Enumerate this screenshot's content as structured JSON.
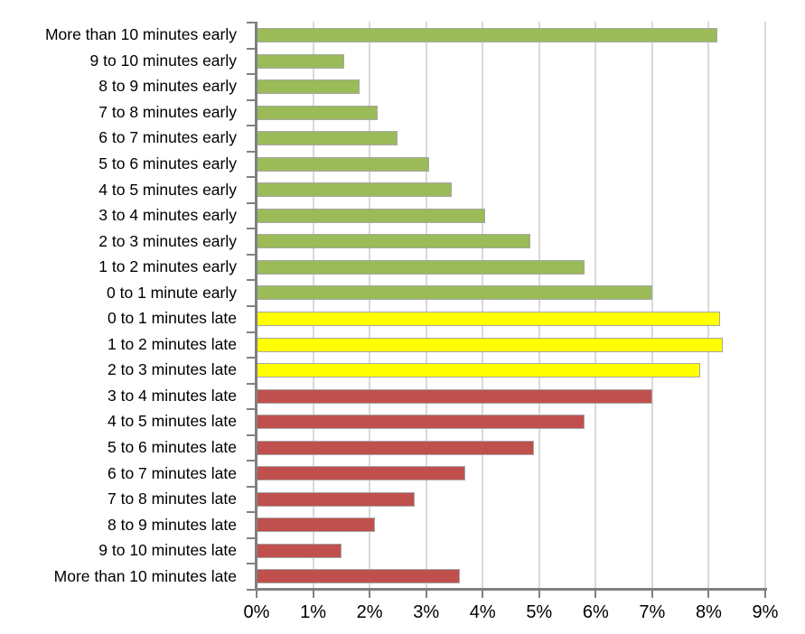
{
  "chart_data": {
    "type": "bar",
    "orientation": "horizontal",
    "title": "",
    "subtitle": "",
    "xlabel": "",
    "ylabel": "",
    "xlim": [
      0,
      9
    ],
    "x_tick_labels": [
      "0%",
      "1%",
      "2%",
      "3%",
      "4%",
      "5%",
      "6%",
      "7%",
      "8%",
      "9%"
    ],
    "x_tick_values": [
      0,
      1,
      2,
      3,
      4,
      5,
      6,
      7,
      8,
      9
    ],
    "value_unit": "%",
    "grid": "vertical",
    "legend": "none",
    "categories": [
      "More than 10 minutes early",
      "9 to 10 minutes early",
      "8 to 9 minutes early",
      "7 to 8 minutes early",
      "6 to 7 minutes early",
      "5 to 6 minutes early",
      "4 to 5 minutes early",
      "3 to 4 minutes early",
      "2 to 3 minutes early",
      "1 to 2 minutes early",
      "0 to 1 minute early",
      "0 to 1 minutes late",
      "1 to 2 minutes late",
      "2 to 3 minutes late",
      "3 to 4 minutes late",
      "4 to 5 minutes late",
      "5 to 6 minutes late",
      "6 to 7 minutes late",
      "7 to 8 minutes late",
      "8 to 9 minutes late",
      "9 to 10 minutes late",
      "More than 10 minutes late"
    ],
    "values": [
      8.15,
      1.55,
      1.83,
      2.15,
      2.5,
      3.05,
      3.45,
      4.05,
      4.85,
      5.8,
      7.0,
      8.2,
      8.25,
      7.85,
      7.0,
      5.8,
      4.9,
      3.7,
      2.8,
      2.1,
      1.5,
      3.6
    ],
    "bar_colors": [
      "#9bbb59",
      "#9bbb59",
      "#9bbb59",
      "#9bbb59",
      "#9bbb59",
      "#9bbb59",
      "#9bbb59",
      "#9bbb59",
      "#9bbb59",
      "#9bbb59",
      "#9bbb59",
      "#ffff00",
      "#ffff00",
      "#ffff00",
      "#c0504d",
      "#c0504d",
      "#c0504d",
      "#c0504d",
      "#c0504d",
      "#c0504d",
      "#c0504d",
      "#c0504d"
    ],
    "color_key": {
      "early": "#9bbb59",
      "on_time": "#ffff00",
      "late": "#c0504d"
    },
    "bar_border_color": "#a6a6a6",
    "gridline_color": "#d9d9d9",
    "axis_color": "#808080"
  }
}
